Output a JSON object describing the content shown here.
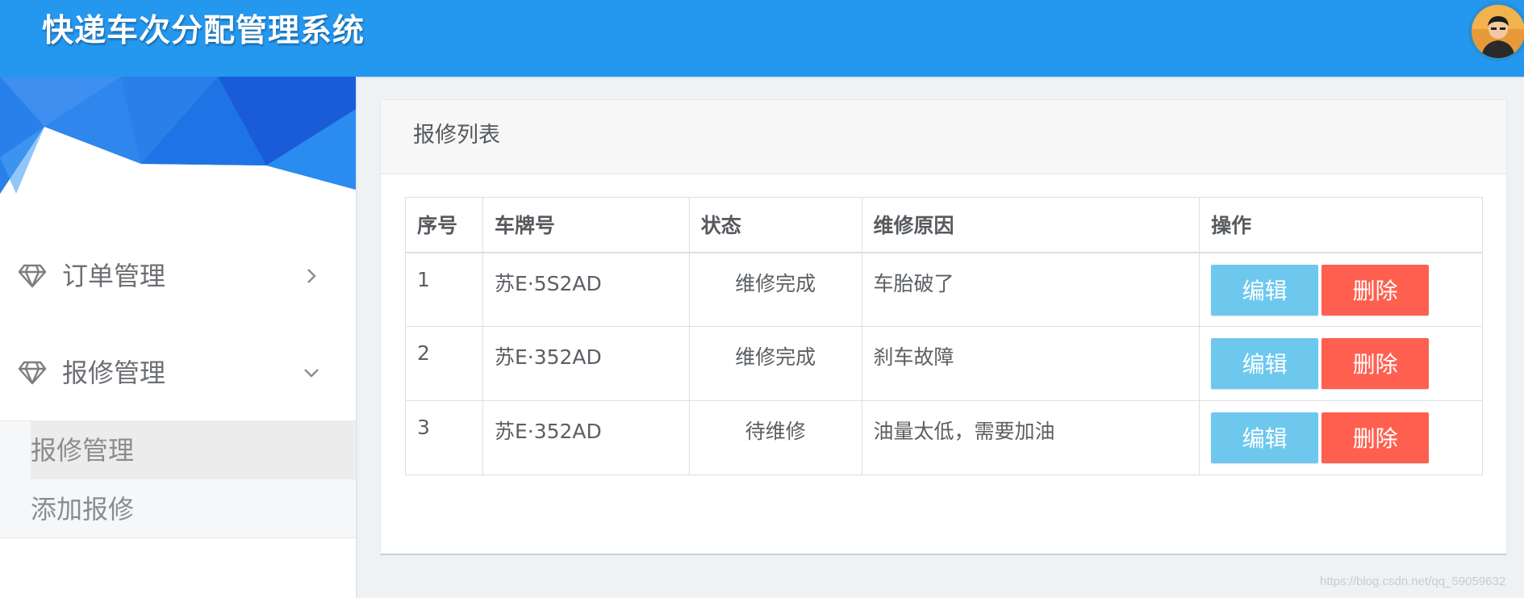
{
  "header": {
    "title": "快递车次分配管理系统"
  },
  "sidebar": {
    "menus": [
      {
        "label": "订单管理",
        "expanded": false
      },
      {
        "label": "报修管理",
        "expanded": true
      }
    ],
    "submenu": [
      {
        "label": "报修管理",
        "active": true
      },
      {
        "label": "添加报修",
        "active": false
      }
    ]
  },
  "panel": {
    "title": "报修列表"
  },
  "table": {
    "columns": [
      "序号",
      "车牌号",
      "状态",
      "维修原因",
      "操作"
    ],
    "rows": [
      {
        "id": "1",
        "plate": "苏E·5S2AD",
        "status": "维修完成",
        "reason": "车胎破了"
      },
      {
        "id": "2",
        "plate": "苏E·352AD",
        "status": "维修完成",
        "reason": "刹车故障"
      },
      {
        "id": "3",
        "plate": "苏E·352AD",
        "status": "待维修",
        "reason": "油量太低，需要加油"
      }
    ],
    "edit_label": "编辑",
    "delete_label": "删除"
  },
  "watermark": "https://blog.csdn.net/qq_59059632",
  "colors": {
    "header": "#2497ef",
    "edit_button": "#6ec8ee",
    "delete_button": "#ff5f4f"
  }
}
